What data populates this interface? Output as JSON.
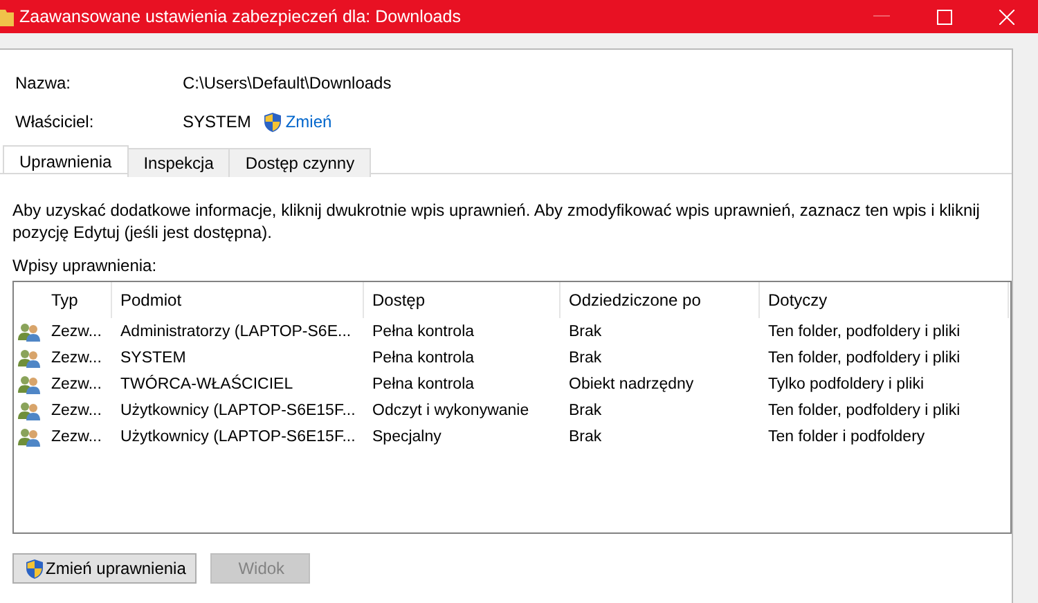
{
  "window": {
    "title": "Zaawansowane ustawienia zabezpieczeń dla: Downloads"
  },
  "fields": [
    {
      "label": "Nazwa:",
      "value": "C:\\Users\\Default\\Downloads"
    },
    {
      "label": "Właściciel:",
      "value": "SYSTEM",
      "link": "Zmień"
    }
  ],
  "tabs": [
    {
      "label": "Uprawnienia",
      "selected": true
    },
    {
      "label": "Inspekcja",
      "selected": false
    },
    {
      "label": "Dostęp czynny",
      "selected": false
    }
  ],
  "info": "Aby uzyskać dodatkowe informacje, kliknij dwukrotnie wpis uprawnień. Aby zmodyfikować wpis uprawnień, zaznacz ten wpis i kliknij pozycję Edytuj (jeśli jest dostępna).",
  "list_label": "Wpisy uprawnienia:",
  "table": {
    "columns": [
      "Typ",
      "Podmiot",
      "Dostęp",
      "Odziedziczone po",
      "Dotyczy"
    ],
    "rows": [
      {
        "cells": [
          "Zezw...",
          "Administratorzy (LAPTOP-S6E...",
          "Pełna kontrola",
          "Brak",
          "Ten folder, podfoldery i pliki"
        ]
      },
      {
        "cells": [
          "Zezw...",
          "SYSTEM",
          "Pełna kontrola",
          "Brak",
          "Ten folder, podfoldery i pliki"
        ]
      },
      {
        "cells": [
          "Zezw...",
          "TWÓRCA-WŁAŚCICIEL",
          "Pełna kontrola",
          "Obiekt nadrzędny",
          "Tylko podfoldery i pliki"
        ]
      },
      {
        "cells": [
          "Zezw...",
          "Użytkownicy (LAPTOP-S6E15F...",
          "Odczyt i wykonywanie",
          "Brak",
          "Ten folder, podfoldery i pliki"
        ]
      },
      {
        "cells": [
          "Zezw...",
          "Użytkownicy (LAPTOP-S6E15F...",
          "Specjalny",
          "Brak",
          "Ten folder i podfoldery"
        ]
      }
    ]
  },
  "buttons": [
    {
      "label": "Zmień uprawnienia",
      "shield": true,
      "disabled": false
    },
    {
      "label": "Widok",
      "shield": false,
      "disabled": true
    }
  ]
}
